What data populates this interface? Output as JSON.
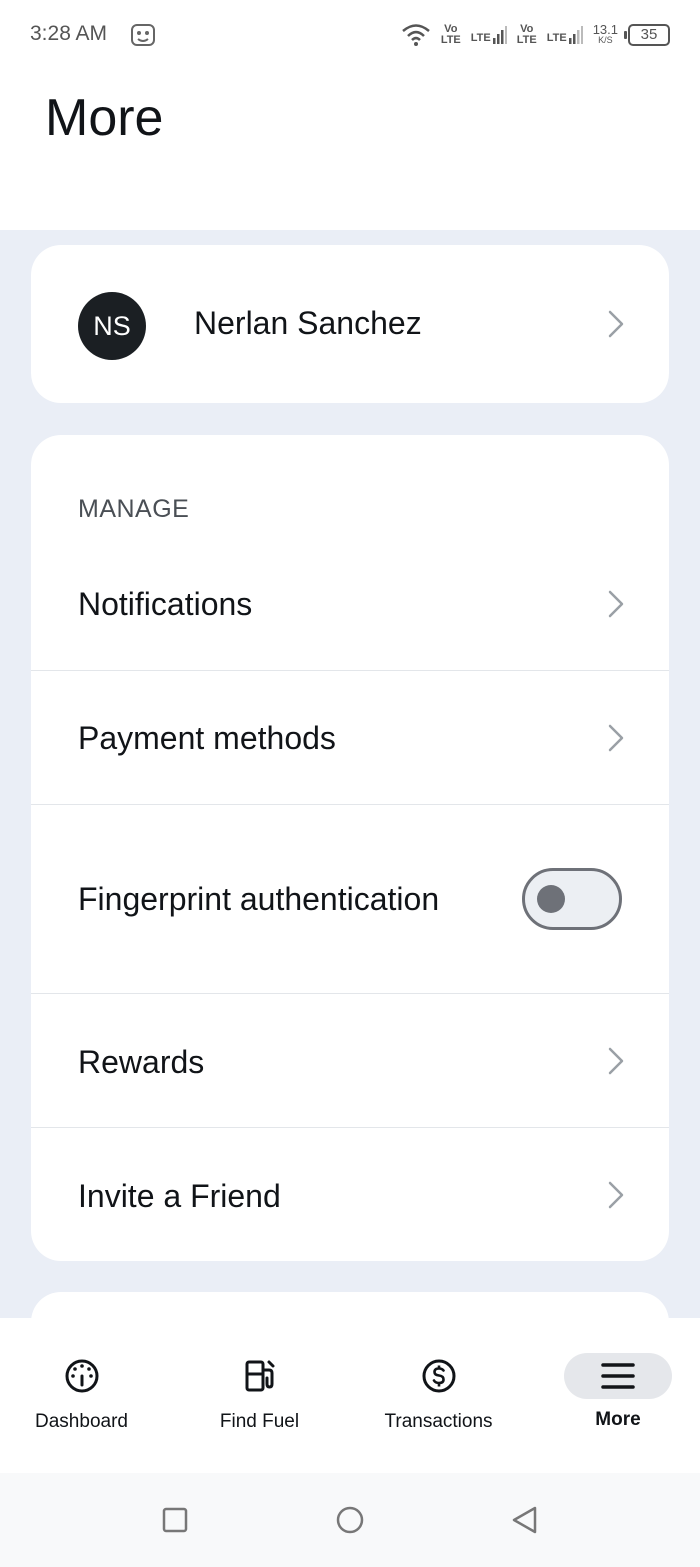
{
  "status_bar": {
    "time": "3:28 AM",
    "network_lines": [
      "Vo",
      "LTE",
      "LTE",
      "Vo",
      "LTE",
      "LTE"
    ],
    "speed_value": "13.1",
    "speed_unit": "K/S",
    "battery": "35"
  },
  "header": {
    "title": "More"
  },
  "profile": {
    "initials": "NS",
    "name": "Nerlan Sanchez"
  },
  "manage": {
    "section_label": "MANAGE",
    "items": [
      {
        "label": "Notifications"
      },
      {
        "label": "Payment methods"
      },
      {
        "label": "Fingerprint authentication",
        "toggle_on": false
      },
      {
        "label": "Rewards"
      },
      {
        "label": "Invite a Friend"
      }
    ]
  },
  "bottom_nav": {
    "items": [
      {
        "label": "Dashboard",
        "icon": "gauge-icon",
        "active": false
      },
      {
        "label": "Find Fuel",
        "icon": "fuel-pump-icon",
        "active": false
      },
      {
        "label": "Transactions",
        "icon": "dollar-circle-icon",
        "active": false
      },
      {
        "label": "More",
        "icon": "menu-icon",
        "active": true
      }
    ]
  },
  "colors": {
    "background": "#eaeef6",
    "card": "#ffffff",
    "avatar": "#1b1f23",
    "chevron": "#9aa0a6",
    "toggle_off": "#6e7178"
  }
}
